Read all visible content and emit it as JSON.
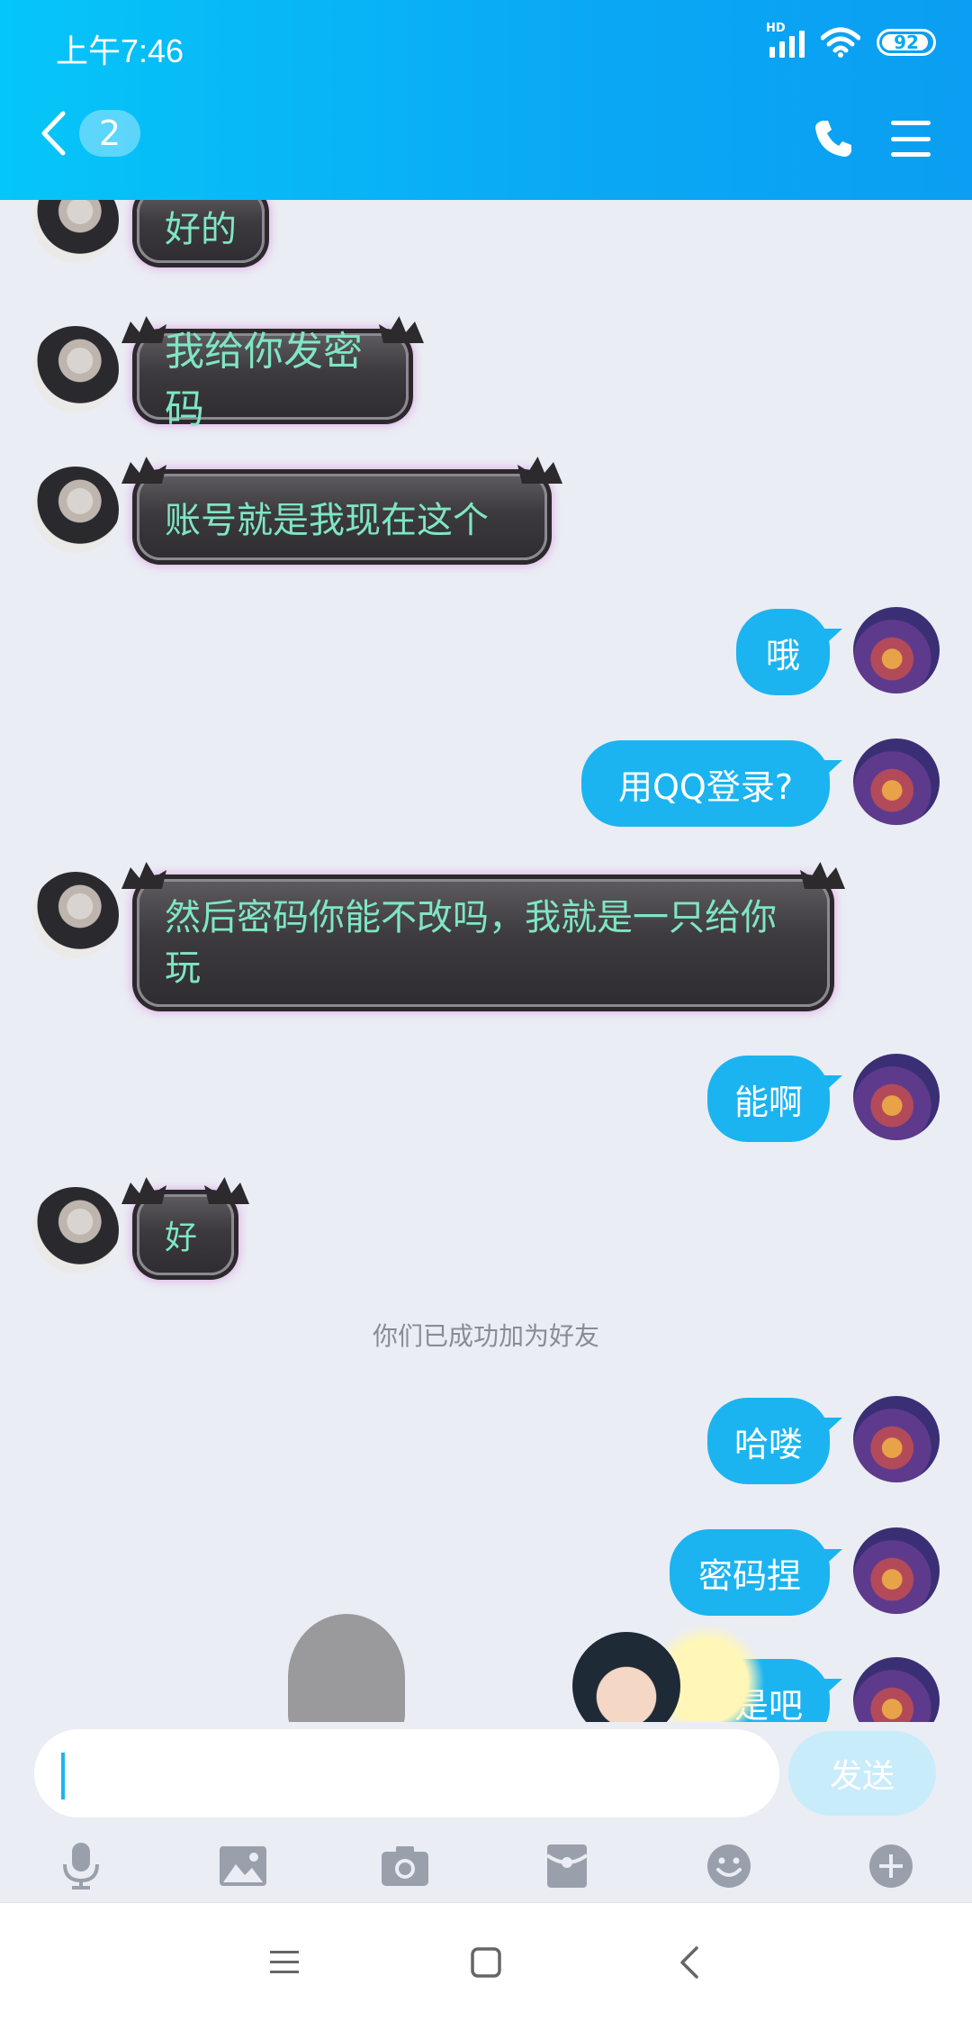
{
  "status_bar": {
    "time": "上午7:46",
    "battery": "92",
    "network_label": "HD"
  },
  "header": {
    "unread_count": "2"
  },
  "messages": [
    {
      "side": "friend",
      "style": "dark",
      "text": "好的"
    },
    {
      "side": "friend",
      "style": "dark",
      "text": "我给你发密码"
    },
    {
      "side": "friend",
      "style": "dark",
      "text": "账号就是我现在这个"
    },
    {
      "side": "self",
      "style": "blue",
      "text": "哦"
    },
    {
      "side": "self",
      "style": "blue",
      "text": "用QQ登录?"
    },
    {
      "side": "friend",
      "style": "dark",
      "text": "然后密码你能不改吗，我就是一只给你玩"
    },
    {
      "side": "self",
      "style": "blue",
      "text": "能啊"
    },
    {
      "side": "friend",
      "style": "dark",
      "text": "好"
    },
    {
      "side": "self",
      "style": "blue",
      "text": "哈喽"
    },
    {
      "side": "self",
      "style": "blue",
      "text": "密码捏"
    },
    {
      "side": "self",
      "style": "blue",
      "text": "是吧"
    }
  ],
  "system_note": "你们已成功加为好友",
  "input": {
    "value": "",
    "send_label": "发送"
  },
  "toolbar": [
    "mic-icon",
    "image-icon",
    "camera-icon",
    "red-packet-icon",
    "emoji-icon",
    "plus-icon"
  ],
  "colors": {
    "header": "#0aaaf5",
    "self_bubble": "#1bb4f1",
    "friend_text": "#7fe6c2",
    "background": "#eaedf4"
  }
}
